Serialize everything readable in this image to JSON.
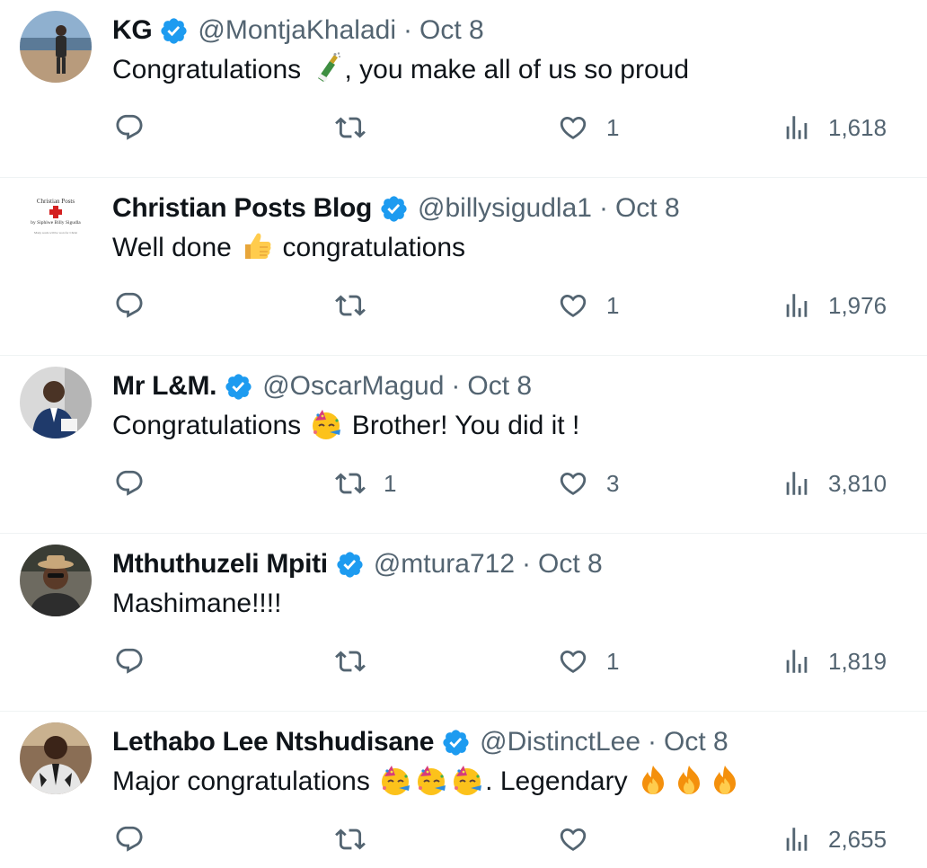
{
  "colors": {
    "verified": "#1d9bf0",
    "text": "#0f1419",
    "muted": "#536471",
    "divider": "#eff3f4"
  },
  "icons": {
    "reply": "reply-icon",
    "retweet": "retweet-icon",
    "like": "heart-icon",
    "views": "views-icon",
    "verified": "verified-badge-icon"
  },
  "tweets": [
    {
      "name": "KG",
      "handle": "@MontjaKhaladi",
      "separator": "·",
      "date": "Oct 8",
      "text_parts": [
        "Congratulations ",
        ", you make all of us so proud"
      ],
      "emojis": [
        "champagne"
      ],
      "replies": "",
      "retweets": "",
      "likes": "1",
      "views": "1,618"
    },
    {
      "name": "Christian Posts Blog",
      "handle": "@billysigudla1",
      "separator": "·",
      "date": "Oct 8",
      "text_parts": [
        "Well done ",
        " congratulations"
      ],
      "emojis": [
        "thumbs-up"
      ],
      "avatar_text": [
        "Christian Posts",
        "by Siphiwe Billy Sigudla",
        "Many souls will be won for Christ"
      ],
      "replies": "",
      "retweets": "",
      "likes": "1",
      "views": "1,976"
    },
    {
      "name": "Mr L&M.",
      "handle": "@OscarMagud",
      "separator": "·",
      "date": "Oct 8",
      "text_parts": [
        "Congratulations ",
        " Brother! You did it !"
      ],
      "emojis": [
        "partying-face"
      ],
      "replies": "",
      "retweets": "1",
      "likes": "3",
      "views": "3,810"
    },
    {
      "name": "Mthuthuzeli Mpiti",
      "handle": "@mtura712",
      "separator": "·",
      "date": "Oct 8",
      "text_parts": [
        "Mashimane!!!!"
      ],
      "emojis": [],
      "replies": "",
      "retweets": "",
      "likes": "1",
      "views": "1,819"
    },
    {
      "name": "Lethabo Lee Ntshudisane",
      "handle": "@DistinctLee",
      "separator": "·",
      "date": "Oct 8",
      "text_parts": [
        "Major congratulations ",
        ". Legendary "
      ],
      "emojis": [
        "partying-face",
        "partying-face",
        "partying-face",
        "fire",
        "fire",
        "fire"
      ],
      "replies": "",
      "retweets": "",
      "likes": "",
      "views": "2,655"
    }
  ]
}
